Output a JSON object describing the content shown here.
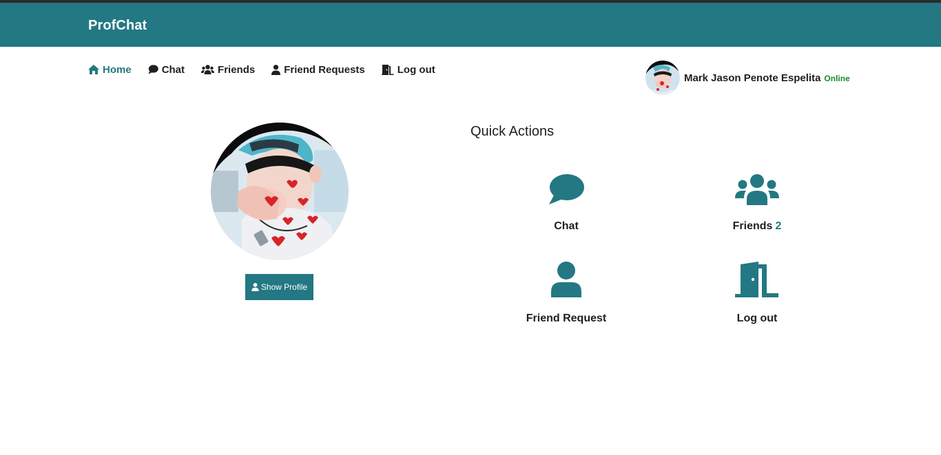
{
  "app": {
    "title": "ProfChat"
  },
  "nav": {
    "items": [
      {
        "label": "Home",
        "icon": "home-icon",
        "active": true
      },
      {
        "label": "Chat",
        "icon": "comment-icon"
      },
      {
        "label": "Friends",
        "icon": "users-icon"
      },
      {
        "label": "Friend Requests",
        "icon": "user-icon"
      },
      {
        "label": "Log out",
        "icon": "door-icon"
      }
    ]
  },
  "user": {
    "name": "Mark Jason Penote Espelita",
    "status": "Online"
  },
  "profile": {
    "show_profile_label": "Show Profile"
  },
  "quick_actions": {
    "title": "Quick Actions",
    "items": [
      {
        "label": "Chat",
        "icon": "comment-icon"
      },
      {
        "label": "Friends",
        "icon": "users-icon",
        "count": "2"
      },
      {
        "label": "Friend Request",
        "icon": "user-icon"
      },
      {
        "label": "Log out",
        "icon": "door-icon"
      }
    ]
  },
  "colors": {
    "brand": "#237883",
    "online": "#1d8a2a",
    "text": "#1f1f1f"
  }
}
